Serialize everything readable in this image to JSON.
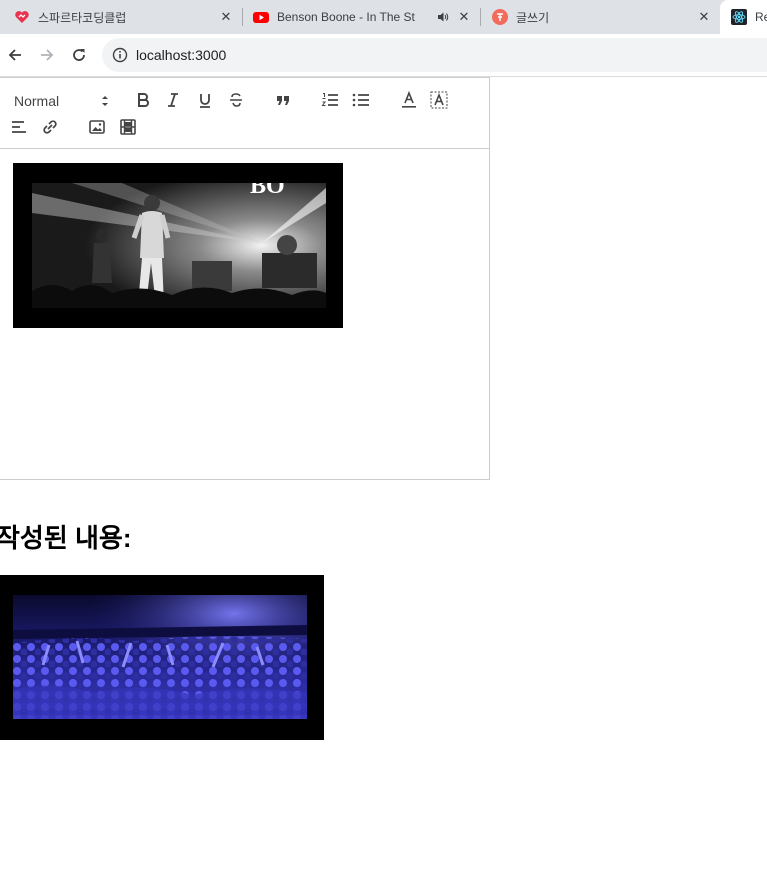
{
  "tabs": [
    {
      "title": "스파르타코딩클럽",
      "favicon": "spartacoding-heart-icon",
      "active": false
    },
    {
      "title": "Benson Boone - In The Stars",
      "favicon": "youtube-icon",
      "active": false,
      "audio": true
    },
    {
      "title": "글쓰기",
      "favicon": "writing-app-icon",
      "active": false
    },
    {
      "title": "React App",
      "favicon": "react-icon",
      "active": true
    }
  ],
  "tab_close_glyph": "✕",
  "address_bar": {
    "url": "localhost:3000",
    "info_icon": "info-icon"
  },
  "editor": {
    "header_picker": {
      "selected": "Normal"
    },
    "toolbar_buttons": [
      "bold",
      "italic",
      "underline",
      "strike",
      "blockquote",
      "ordered-list",
      "bullet-list",
      "text-color",
      "background-color",
      "align",
      "link",
      "image",
      "video"
    ],
    "content_image": "black-and-white concert photo"
  },
  "result": {
    "title": "작성된 내용:",
    "image": "blue-tinted concert crowd photo"
  },
  "colors": {
    "tab_strip": "#dee1e6",
    "toolbar_icon": "#444444",
    "editor_border": "#cccccc",
    "youtube_red": "#ff0000"
  }
}
